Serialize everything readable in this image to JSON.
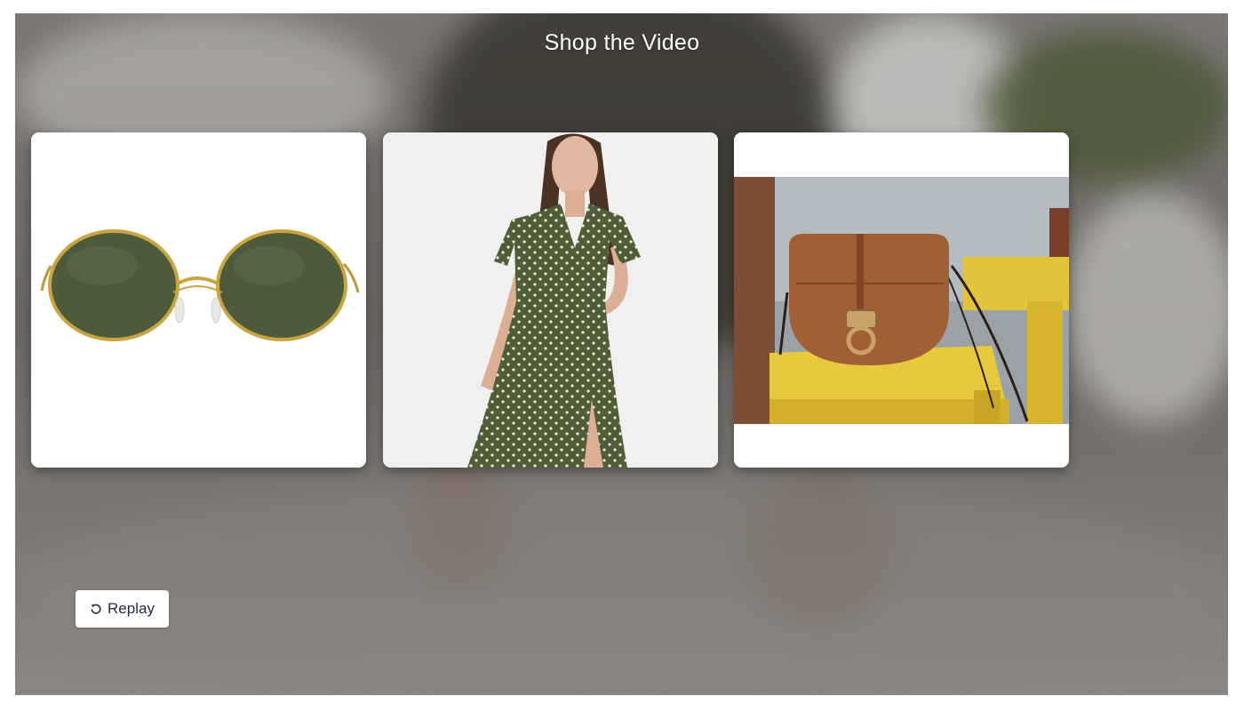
{
  "overlay": {
    "title": "Shop the Video"
  },
  "products": [
    {
      "name": "sunglasses",
      "icon": "round-sunglasses-image"
    },
    {
      "name": "dress",
      "icon": "polka-dot-dress-image"
    },
    {
      "name": "bag",
      "icon": "brown-saddle-bag-image"
    }
  ],
  "controls": {
    "replay_label": "Replay",
    "replay_icon": "replay-icon"
  },
  "colors": {
    "title_text": "#ffffff",
    "button_text": "#1f2d44",
    "card_background": "#ffffff"
  }
}
